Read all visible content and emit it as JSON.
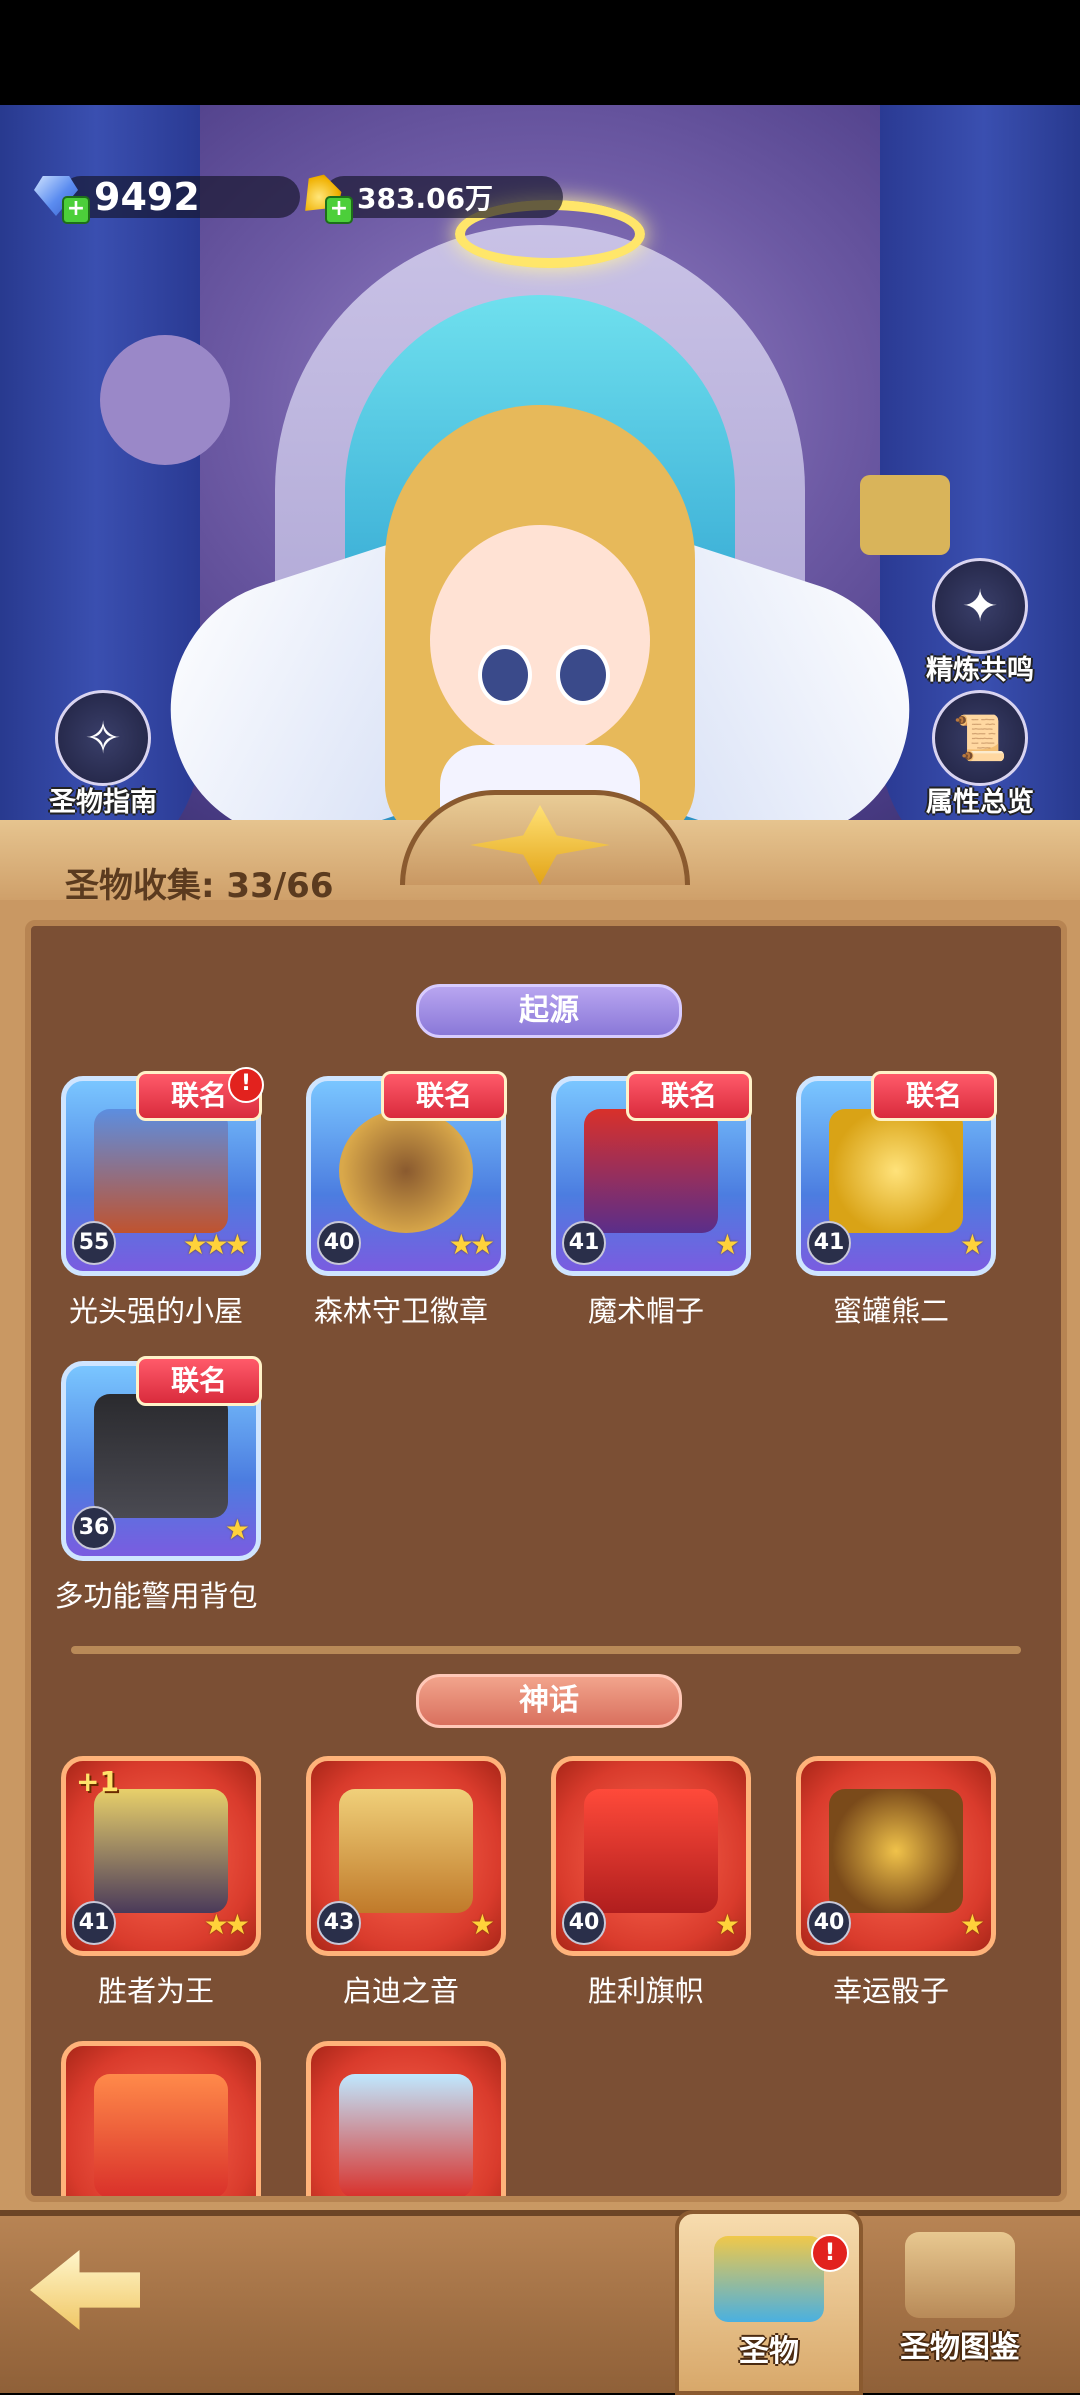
{
  "currency": {
    "gems": "9492",
    "coins": "383.06万"
  },
  "side_buttons": {
    "guide": "圣物指南",
    "refine": "精炼共鸣",
    "attributes": "属性总览"
  },
  "panel": {
    "collection_label": "圣物收集: 33/66"
  },
  "sections": {
    "origin": {
      "title": "起源",
      "items": [
        {
          "name": "光头强的小屋",
          "level": "55",
          "tag": "联名",
          "stars": "★★★",
          "alert": "!"
        },
        {
          "name": "森林守卫徽章",
          "level": "40",
          "tag": "联名",
          "stars": "★★"
        },
        {
          "name": "魔术帽子",
          "level": "41",
          "tag": "联名",
          "stars": "★"
        },
        {
          "name": "蜜罐熊二",
          "level": "41",
          "tag": "联名",
          "stars": "★"
        },
        {
          "name": "多功能警用背包",
          "level": "36",
          "tag": "联名",
          "stars": "★"
        }
      ]
    },
    "myth": {
      "title": "神话",
      "items": [
        {
          "name": "胜者为王",
          "level": "41",
          "stars": "★★",
          "badge": "+1"
        },
        {
          "name": "启迪之音",
          "level": "43",
          "stars": "★"
        },
        {
          "name": "胜利旗帜",
          "level": "40",
          "stars": "★"
        },
        {
          "name": "幸运骰子",
          "level": "40",
          "stars": "★"
        }
      ]
    }
  },
  "bottom_nav": {
    "tab_relic": "圣物",
    "tab_codex": "圣物图鉴",
    "relic_alert": "!"
  }
}
